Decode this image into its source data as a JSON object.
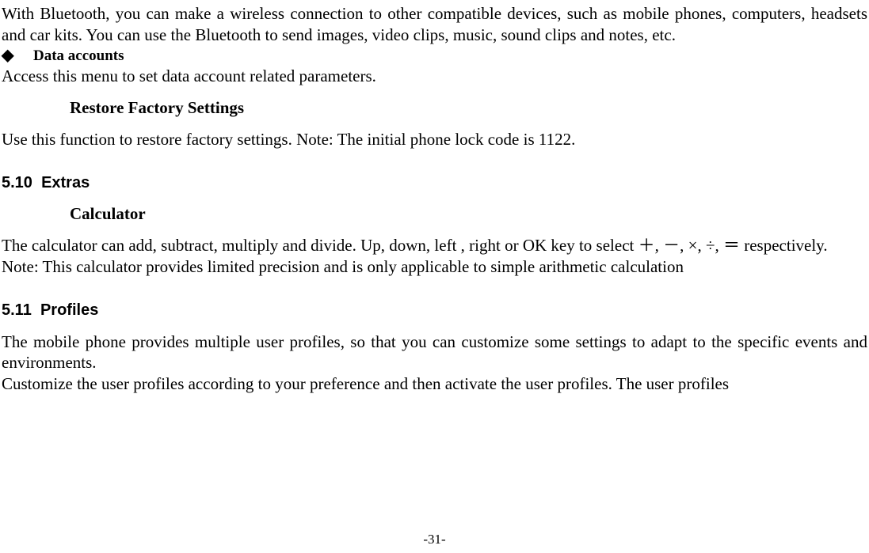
{
  "intro": "With Bluetooth, you can make a wireless connection to other compatible devices, such as mobile phones, computers, headsets and car kits. You can use the Bluetooth to send images, video clips, music, sound clips and notes, etc.",
  "data_accounts": {
    "bullet": "◆",
    "label": "Data accounts",
    "desc": "Access this menu to set data account related parameters."
  },
  "restore": {
    "heading": "Restore Factory Settings",
    "body": "Use this function to restore factory settings. Note: The initial phone lock code is 1122."
  },
  "extras": {
    "number": "5.10",
    "title": "Extras",
    "calc_heading": "Calculator",
    "calc_body": "The calculator can add, subtract, multiply and divide. Up, down, left , right or OK key to select ＋, －, ×, ÷, ＝ respectively.",
    "calc_note": "Note: This calculator provides limited precision and is only applicable to simple arithmetic calculation"
  },
  "profiles": {
    "number": "5.11",
    "title": "Profiles",
    "p1": "The mobile phone provides multiple user profiles, so that you can customize some settings to adapt to the specific events and environments.",
    "p2": "Customize the user profiles according to your preference and then activate the user profiles. The user profiles"
  },
  "page_number": "-31-"
}
